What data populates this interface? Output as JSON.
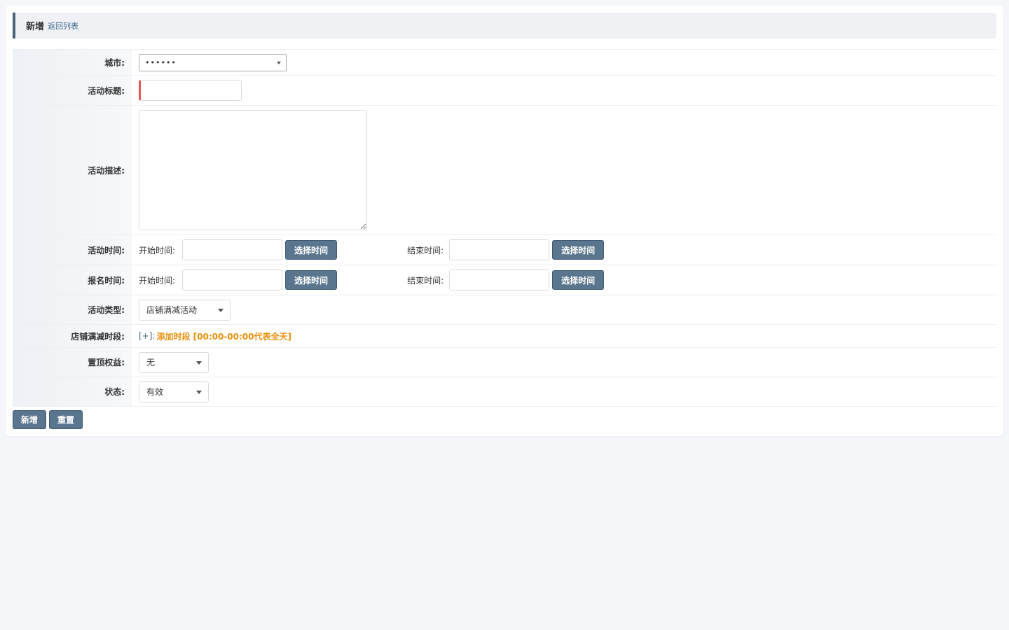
{
  "header": {
    "title": "新增",
    "back_link": "返回列表"
  },
  "form": {
    "city": {
      "label": "城市:",
      "value": "••••••"
    },
    "title": {
      "label": "活动标题:",
      "value": ""
    },
    "description": {
      "label": "活动描述:",
      "value": ""
    },
    "activity_time": {
      "label": "活动时间:",
      "start_label": "开始时间:",
      "end_label": "结束时间:",
      "pick_button": "选择时间"
    },
    "signup_time": {
      "label": "报名时间:",
      "start_label": "开始时间:",
      "end_label": "结束时间:",
      "pick_button": "选择时间"
    },
    "activity_type": {
      "label": "活动类型:",
      "value": "店铺满减活动"
    },
    "discount_period": {
      "label": "店铺满减时段:",
      "add_bracket": "[+]:",
      "add_text": "添加时段 [00:00-00:00代表全天]"
    },
    "top_rights": {
      "label": "置顶权益:",
      "value": "无"
    },
    "status": {
      "label": "状态:",
      "value": "有效"
    }
  },
  "actions": {
    "submit": "新增",
    "reset": "重置"
  },
  "colors": {
    "accent": "#5a768e",
    "link_orange": "#e8900d",
    "required": "#e45656"
  }
}
